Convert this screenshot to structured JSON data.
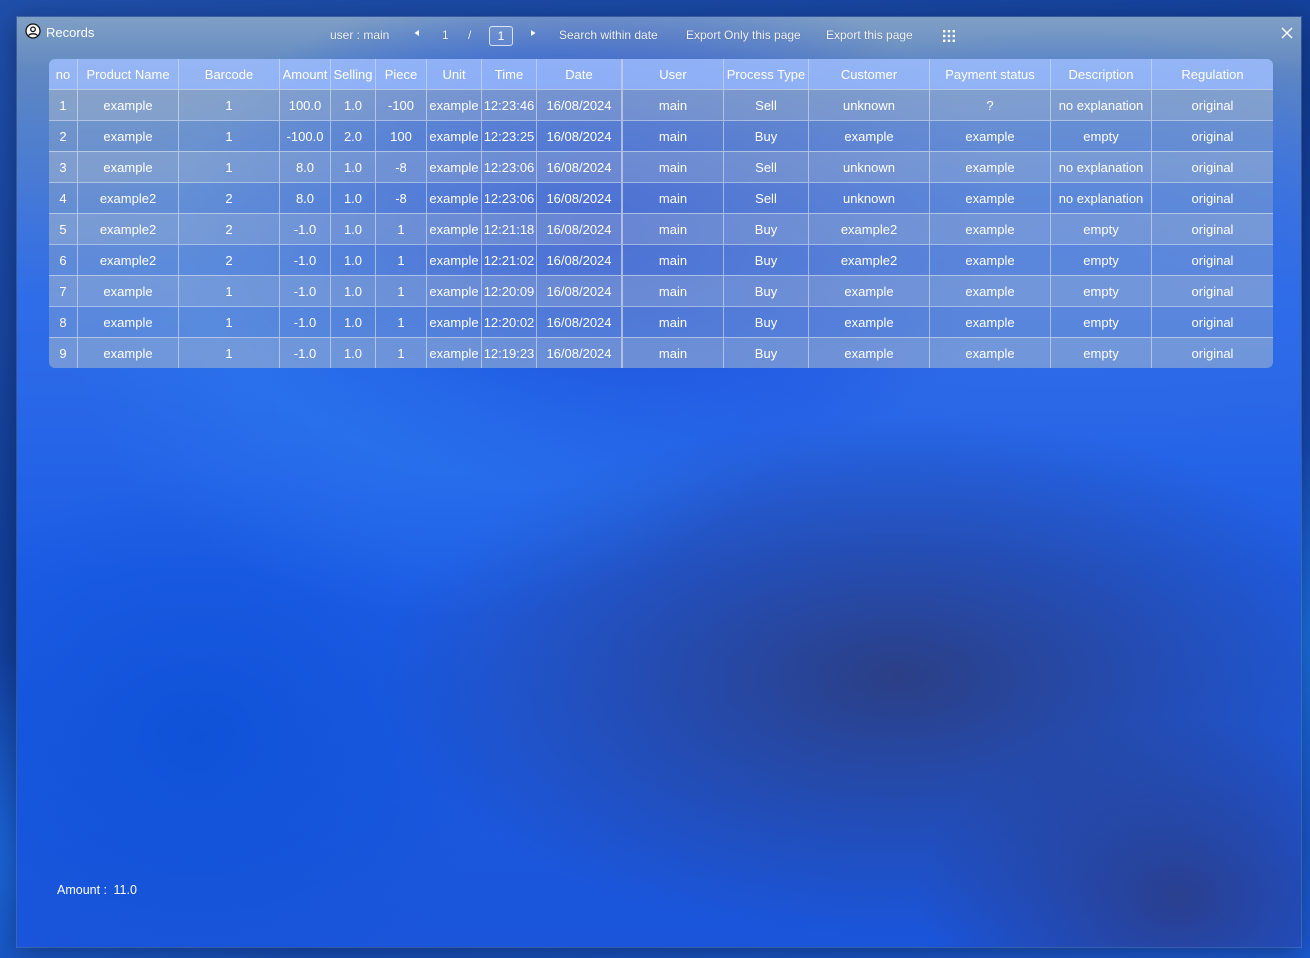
{
  "window": {
    "title": "Records",
    "user_label": "user : main",
    "pager": {
      "current": "1",
      "separator": "/",
      "total": "1"
    },
    "actions": {
      "search_within_date": "Search within date",
      "export_only_this_page": "Export Only this page",
      "export_this_page": "Export this page"
    },
    "icons": {
      "app": "user-circle-icon",
      "prev": "triangle-left-icon",
      "next": "triangle-right-icon",
      "grid": "grid-dots-icon",
      "close": "close-icon"
    }
  },
  "table": {
    "columns": [
      "no",
      "Product Name",
      "Barcode",
      "Amount",
      "Selling",
      "Piece",
      "Unit",
      "Time",
      "Date",
      "User",
      "Process Type",
      "Customer",
      "Payment status",
      "Description",
      "Regulation"
    ],
    "rows": [
      [
        "1",
        "example",
        "1",
        "100.0",
        "1.0",
        "-100",
        "example",
        "12:23:46",
        "16/08/2024",
        "main",
        "Sell",
        "unknown",
        "?",
        "no explanation",
        "original"
      ],
      [
        "2",
        "example",
        "1",
        "-100.0",
        "2.0",
        "100",
        "example",
        "12:23:25",
        "16/08/2024",
        "main",
        "Buy",
        "example",
        "example",
        "empty",
        "original"
      ],
      [
        "3",
        "example",
        "1",
        "8.0",
        "1.0",
        "-8",
        "example",
        "12:23:06",
        "16/08/2024",
        "main",
        "Sell",
        "unknown",
        "example",
        "no explanation",
        "original"
      ],
      [
        "4",
        "example2",
        "2",
        "8.0",
        "1.0",
        "-8",
        "example",
        "12:23:06",
        "16/08/2024",
        "main",
        "Sell",
        "unknown",
        "example",
        "no explanation",
        "original"
      ],
      [
        "5",
        "example2",
        "2",
        "-1.0",
        "1.0",
        "1",
        "example",
        "12:21:18",
        "16/08/2024",
        "main",
        "Buy",
        "example2",
        "example",
        "empty",
        "original"
      ],
      [
        "6",
        "example2",
        "2",
        "-1.0",
        "1.0",
        "1",
        "example",
        "12:21:02",
        "16/08/2024",
        "main",
        "Buy",
        "example2",
        "example",
        "empty",
        "original"
      ],
      [
        "7",
        "example",
        "1",
        "-1.0",
        "1.0",
        "1",
        "example",
        "12:20:09",
        "16/08/2024",
        "main",
        "Buy",
        "example",
        "example",
        "empty",
        "original"
      ],
      [
        "8",
        "example",
        "1",
        "-1.0",
        "1.0",
        "1",
        "example",
        "12:20:02",
        "16/08/2024",
        "main",
        "Buy",
        "example",
        "example",
        "empty",
        "original"
      ],
      [
        "9",
        "example",
        "1",
        "-1.0",
        "1.0",
        "1",
        "example",
        "12:19:23",
        "16/08/2024",
        "main",
        "Buy",
        "example",
        "example",
        "empty",
        "original"
      ]
    ]
  },
  "footer": {
    "amount_label": "Amount :",
    "amount_value": "11.0"
  }
}
